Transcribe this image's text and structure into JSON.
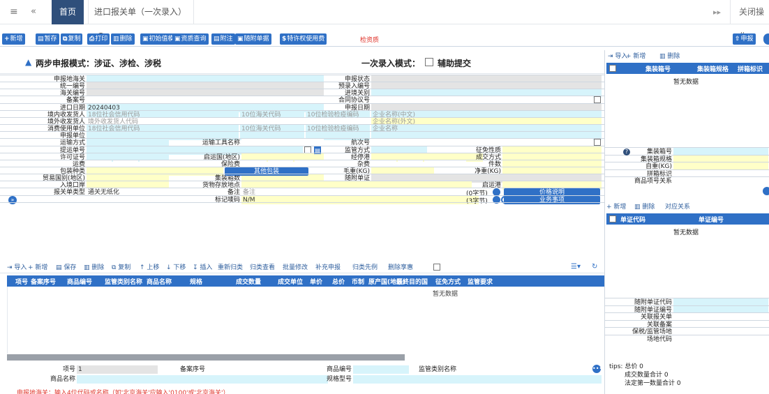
{
  "tabs": {
    "home": "首页",
    "entry": "进口报关单（一次录入）",
    "close_ops": "关闭操作"
  },
  "toolbar": [
    "新增",
    "暂存",
    "复制",
    "打印",
    "删除",
    "初始值模板",
    "资质查询",
    "附注",
    "随附单据",
    "特许权使用费"
  ],
  "toolbar_icons": [
    "+",
    "▤",
    "⧉",
    "⎙",
    "▥",
    "▣",
    "▣",
    "▤",
    "▣",
    "$"
  ],
  "toolbar_link": "检资质",
  "declare_label": "申报",
  "banner": {
    "title": "两步申报模式：涉证、涉检、涉税",
    "mode": "一次录入模式：",
    "assist": "辅助提交"
  },
  "form": {
    "l": {
      "decl_customs": "申报地海关",
      "unified_no": "统一编号",
      "customs_no": "海关编号",
      "record_no": "备案号",
      "import_date": "进口日期",
      "domestic_consignee": "境内收发货人",
      "foreign_consignee": "境外收发货人",
      "consumer_unit": "消费使用单位",
      "declarant": "申报单位",
      "transport_mode": "运输方式",
      "bl_no": "提运单号",
      "license_no": "许可证号",
      "freight": "运费",
      "package_type": "包装种类",
      "trade_country": "贸易国别(地区)",
      "entry_port": "入境口岸",
      "decl_type": "报关单类型",
      "conveyance": "运输工具名称",
      "origin_country": "启运国(地区)",
      "insurance": "保险费",
      "container_count": "集装箱数",
      "storage_place": "货物存放地点",
      "remark": "备注",
      "mark_code": "标记唛码",
      "decl_status": "申报状态",
      "preentry_no": "预录入编号",
      "entry_customs": "进境关别",
      "contract_no": "合同协议号",
      "decl_date": "申报日期",
      "voyage_no": "航次号",
      "supervision": "监管方式",
      "via_port": "经停港",
      "misc_fee": "杂费",
      "gross_wt": "毛重(KG)",
      "attach_docs": "随附单证",
      "levy_nature": "征免性质",
      "deal_mode": "成交方式",
      "pieces": "件数",
      "net_wt": "净重(KG)",
      "dep_port": "启运港"
    },
    "v": {
      "import_date": "20240403",
      "decl_type": "通关无纸化",
      "mark_code": "N/M",
      "remark_ph": "备注",
      "bytes0": "(0字节)",
      "bytes3": "(3字节)"
    },
    "ph": {
      "credit": "18位社会信用代码",
      "customs10": "10位海关代码",
      "insp10": "10位检验检疫编码",
      "name_cn": "企业名称(中文)",
      "name_en": "企业名称(外文)",
      "foreign_code": "境外收发货人代码",
      "name": "企业名称"
    },
    "btn": {
      "other_pkg": "其他包装",
      "price_note": "价格说明",
      "service": "业务事项"
    }
  },
  "goods": {
    "tools": [
      "导入",
      "新增",
      "保存",
      "删除",
      "复制",
      "上移",
      "下移",
      "插入",
      "重新归类",
      "归类查看",
      "批量修改",
      "补充申报",
      "归类先例",
      "删除享惠"
    ],
    "cols": [
      "项号",
      "备案序号",
      "商品编号",
      "监管类别名称",
      "商品名称",
      "规格",
      "成交数量",
      "成交单位",
      "单价",
      "总价",
      "币制",
      "原产国(地区)",
      "最终目的国",
      "征免方式",
      "监管要求"
    ],
    "empty": "暂无数据"
  },
  "detail": {
    "item_no": "项号",
    "item_val": "1",
    "record_seq": "备案序号",
    "goods_code": "商品编号",
    "sup_cat": "监管类别名称",
    "goods_name": "商品名称",
    "spec_model": "规格型号"
  },
  "status": "申报地海关：输入4位代码或名称（如'北京海关'应输入'0100'或'北京海关'）",
  "right": {
    "tools": [
      "导入",
      "新增",
      "删除"
    ],
    "container_cols": [
      "集装箱号",
      "集装箱规格",
      "拼箱标识"
    ],
    "empty": "暂无数据",
    "c_labels": [
      "集装箱号",
      "集装箱规格",
      "自重(KG)",
      "拼箱标识",
      "商品项号关系"
    ],
    "doc_tools": [
      "新增",
      "删除",
      "对应关系"
    ],
    "doc_cols": [
      "单证代码",
      "单证编号"
    ],
    "doc_empty": "暂无数据",
    "b_labels": [
      "随附单证代码",
      "随附单证编号",
      "关联报关单",
      "关联备案",
      "保税/监管场地",
      "场地代码"
    ],
    "tips": [
      "tips: 总价 0",
      "成交数量合计 0",
      "法定第一数量合计 0"
    ]
  }
}
